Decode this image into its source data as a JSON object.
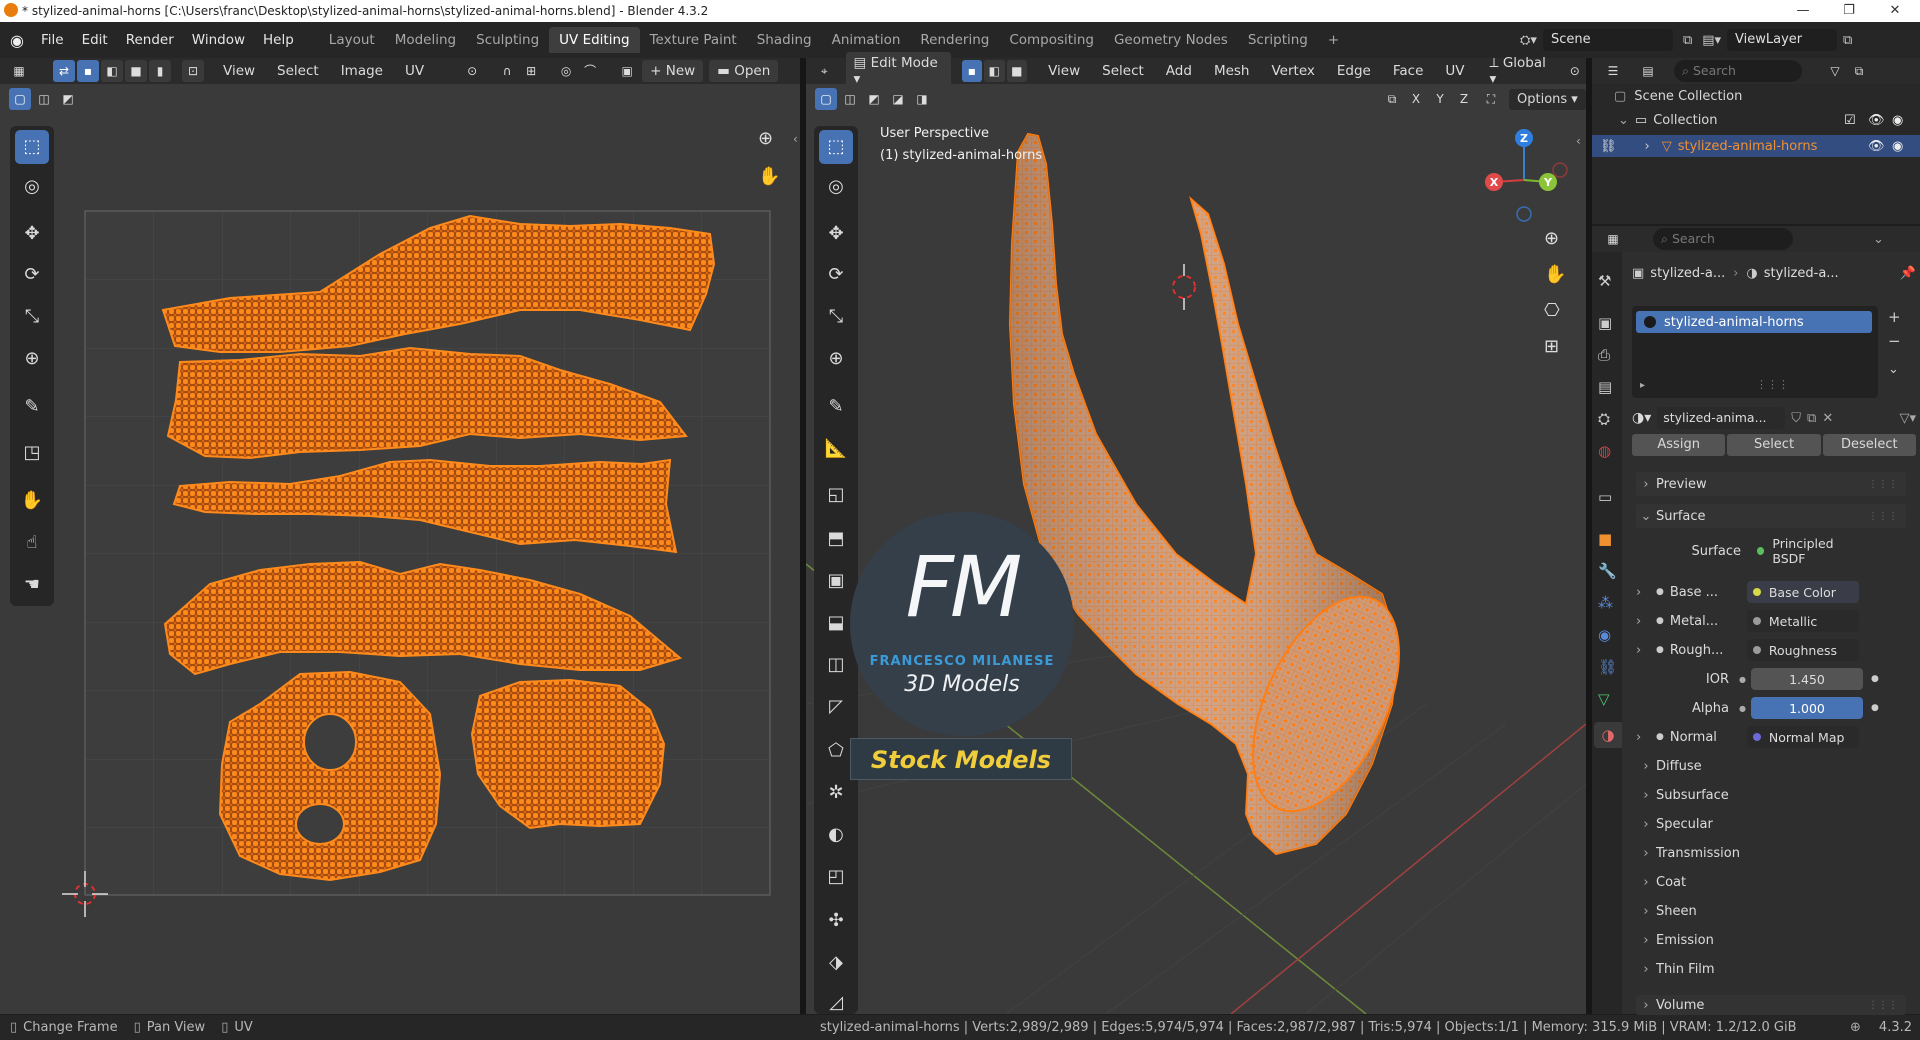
{
  "window": {
    "title": "* stylized-animal-horns [C:\\Users\\franc\\Desktop\\stylized-animal-horns\\stylized-animal-horns.blend] - Blender 4.3.2"
  },
  "menu": [
    "File",
    "Edit",
    "Render",
    "Window",
    "Help"
  ],
  "workspaces": [
    "Layout",
    "Modeling",
    "Sculpting",
    "UV Editing",
    "Texture Paint",
    "Shading",
    "Animation",
    "Rendering",
    "Compositing",
    "Geometry Nodes",
    "Scripting"
  ],
  "active_workspace": "UV Editing",
  "scene": {
    "name": "Scene",
    "view_layer": "ViewLayer"
  },
  "uv_editor": {
    "menus": [
      "View",
      "Select",
      "Image",
      "UV"
    ],
    "new_label": "New",
    "open_label": "Open"
  },
  "viewport": {
    "mode": "Edit Mode",
    "menus": [
      "View",
      "Select",
      "Add",
      "Mesh",
      "Vertex",
      "Edge",
      "Face",
      "UV"
    ],
    "orientation": "Global",
    "axes": [
      "X",
      "Y",
      "Z"
    ],
    "options_label": "Options",
    "overlay_line1": "User Perspective",
    "overlay_line2": "(1) stylized-animal-horns",
    "gizmo_axes": {
      "x": "X",
      "y": "Y",
      "z": "Z"
    }
  },
  "watermark": {
    "logo": "FM",
    "company": "FRANCESCO MILANESE",
    "sub": "3D Models",
    "banner": "Stock Models"
  },
  "outliner": {
    "search_placeholder": "Search",
    "scene_collection": "Scene Collection",
    "collection": "Collection",
    "object": "stylized-animal-horns"
  },
  "properties": {
    "search_placeholder": "Search",
    "breadcrumb_object": "stylized-a...",
    "breadcrumb_material": "stylized-a...",
    "material_slot": "stylized-animal-horns",
    "material_name": "stylized-anima...",
    "assign": "Assign",
    "select": "Select",
    "deselect": "Deselect",
    "preview": "Preview",
    "surface_section": "Surface",
    "rows": [
      {
        "label": "Surface",
        "value": "Principled BSDF",
        "dot": "#5bbd5b"
      },
      {
        "label": "Base ...",
        "value": "Base Color",
        "dot": "#d8d84a"
      },
      {
        "label": "Metal...",
        "value": "Metallic",
        "dot": "#9a9a9a"
      },
      {
        "label": "Rough...",
        "value": "Roughness",
        "dot": "#9a9a9a"
      },
      {
        "label": "IOR",
        "value": "1.450",
        "dot": "#9a9a9a"
      },
      {
        "label": "Alpha",
        "value": "1.000",
        "dot": "#9a9a9a"
      },
      {
        "label": "Normal",
        "value": "Normal Map",
        "dot": "#6a6ad8"
      }
    ],
    "subsections": [
      "Diffuse",
      "Subsurface",
      "Specular",
      "Transmission",
      "Coat",
      "Sheen",
      "Emission",
      "Thin Film"
    ],
    "volume": "Volume"
  },
  "status": {
    "left": [
      "Change Frame",
      "Pan View",
      "UV"
    ],
    "stats": "stylized-animal-horns | Verts:2,989/2,989 | Edges:5,974/5,974 | Faces:2,987/2,987 | Tris:5,974 | Objects:1/1 | Memory: 315.9 MiB | VRAM: 1.2/12.0 GiB",
    "version": "4.3.2"
  },
  "colors": {
    "accent": "#4772b3",
    "mesh": "#f58220",
    "bg": "#3a3a3a"
  }
}
